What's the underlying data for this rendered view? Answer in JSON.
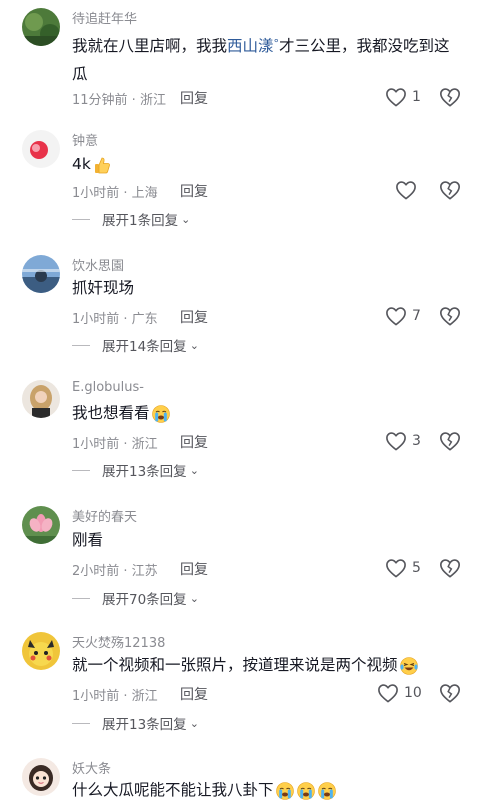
{
  "comments": [
    {
      "username": "待追赶年华",
      "text_before": "我就在八里店啊，我我",
      "link": "西山漾",
      "link_icon": "location-pin-icon",
      "text_after": "才三公里，我都没吃到这瓜",
      "time_location": "11分钟前 · 浙江",
      "reply": "回复",
      "like_count": "1"
    },
    {
      "username": "钟意",
      "text": "4k",
      "emoji": "thumbs-up-emoji",
      "time_location": "1小时前 · 上海",
      "reply": "回复",
      "like_count": "",
      "expand": "展开1条回复"
    },
    {
      "username": "饮水思園",
      "text": "抓奸现场",
      "time_location": "1小时前 · 广东",
      "reply": "回复",
      "like_count": "7",
      "expand": "展开14条回复"
    },
    {
      "username": "E.globulus-",
      "text": "我也想看看",
      "emoji": "crying-face-emoji",
      "time_location": "1小时前 · 浙江",
      "reply": "回复",
      "like_count": "3",
      "expand": "展开13条回复"
    },
    {
      "username": "美好的春天",
      "text": "刚看",
      "time_location": "2小时前 · 江苏",
      "reply": "回复",
      "like_count": "5",
      "expand": "展开70条回复"
    },
    {
      "username": "天火焚殇12138",
      "text": "就一个视频和一张照片，按道理来说是两个视频",
      "emoji": "laughing-crying-emoji",
      "time_location": "1小时前 · 浙江",
      "reply": "回复",
      "like_count": "10",
      "expand": "展开13条回复"
    },
    {
      "username": "妖大条",
      "text": "什么大瓜呢能不能让我八卦下",
      "emoji_count": "3"
    }
  ],
  "icons": {
    "like": "heart-outline-icon",
    "dislike": "broken-heart-icon",
    "expand": "chevron-down-icon"
  },
  "colors": {
    "text": "#161823",
    "secondary": "#8a8b91",
    "link": "#2f5b9a"
  }
}
